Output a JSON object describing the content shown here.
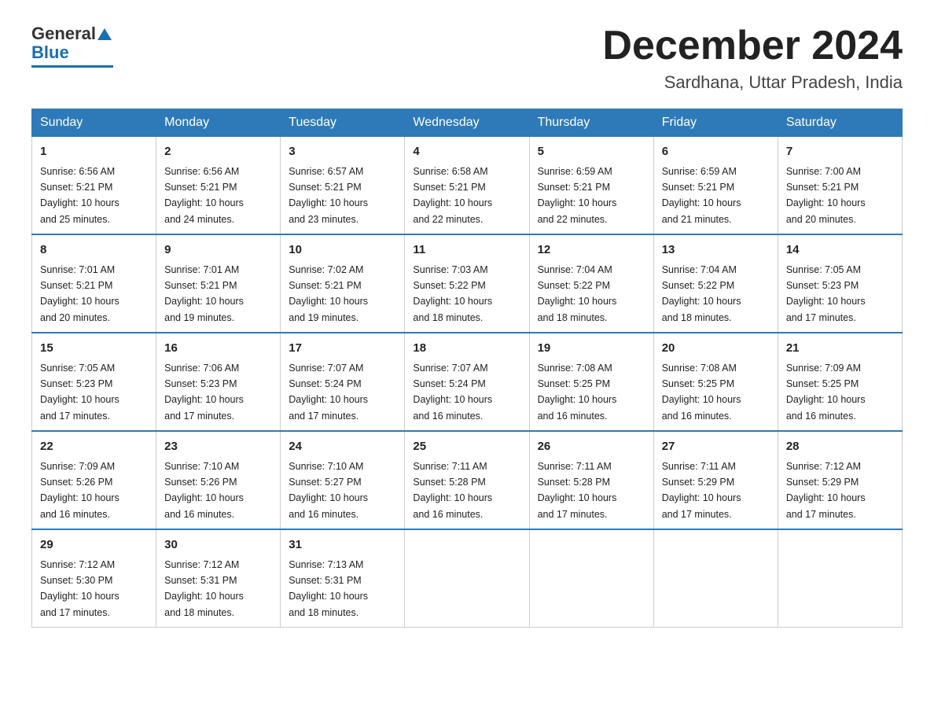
{
  "logo": {
    "general": "General",
    "blue": "Blue"
  },
  "title": {
    "month": "December 2024",
    "location": "Sardhana, Uttar Pradesh, India"
  },
  "headers": [
    "Sunday",
    "Monday",
    "Tuesday",
    "Wednesday",
    "Thursday",
    "Friday",
    "Saturday"
  ],
  "weeks": [
    [
      {
        "day": "1",
        "sunrise": "6:56 AM",
        "sunset": "5:21 PM",
        "daylight": "10 hours and 25 minutes."
      },
      {
        "day": "2",
        "sunrise": "6:56 AM",
        "sunset": "5:21 PM",
        "daylight": "10 hours and 24 minutes."
      },
      {
        "day": "3",
        "sunrise": "6:57 AM",
        "sunset": "5:21 PM",
        "daylight": "10 hours and 23 minutes."
      },
      {
        "day": "4",
        "sunrise": "6:58 AM",
        "sunset": "5:21 PM",
        "daylight": "10 hours and 22 minutes."
      },
      {
        "day": "5",
        "sunrise": "6:59 AM",
        "sunset": "5:21 PM",
        "daylight": "10 hours and 22 minutes."
      },
      {
        "day": "6",
        "sunrise": "6:59 AM",
        "sunset": "5:21 PM",
        "daylight": "10 hours and 21 minutes."
      },
      {
        "day": "7",
        "sunrise": "7:00 AM",
        "sunset": "5:21 PM",
        "daylight": "10 hours and 20 minutes."
      }
    ],
    [
      {
        "day": "8",
        "sunrise": "7:01 AM",
        "sunset": "5:21 PM",
        "daylight": "10 hours and 20 minutes."
      },
      {
        "day": "9",
        "sunrise": "7:01 AM",
        "sunset": "5:21 PM",
        "daylight": "10 hours and 19 minutes."
      },
      {
        "day": "10",
        "sunrise": "7:02 AM",
        "sunset": "5:21 PM",
        "daylight": "10 hours and 19 minutes."
      },
      {
        "day": "11",
        "sunrise": "7:03 AM",
        "sunset": "5:22 PM",
        "daylight": "10 hours and 18 minutes."
      },
      {
        "day": "12",
        "sunrise": "7:04 AM",
        "sunset": "5:22 PM",
        "daylight": "10 hours and 18 minutes."
      },
      {
        "day": "13",
        "sunrise": "7:04 AM",
        "sunset": "5:22 PM",
        "daylight": "10 hours and 18 minutes."
      },
      {
        "day": "14",
        "sunrise": "7:05 AM",
        "sunset": "5:23 PM",
        "daylight": "10 hours and 17 minutes."
      }
    ],
    [
      {
        "day": "15",
        "sunrise": "7:05 AM",
        "sunset": "5:23 PM",
        "daylight": "10 hours and 17 minutes."
      },
      {
        "day": "16",
        "sunrise": "7:06 AM",
        "sunset": "5:23 PM",
        "daylight": "10 hours and 17 minutes."
      },
      {
        "day": "17",
        "sunrise": "7:07 AM",
        "sunset": "5:24 PM",
        "daylight": "10 hours and 17 minutes."
      },
      {
        "day": "18",
        "sunrise": "7:07 AM",
        "sunset": "5:24 PM",
        "daylight": "10 hours and 16 minutes."
      },
      {
        "day": "19",
        "sunrise": "7:08 AM",
        "sunset": "5:25 PM",
        "daylight": "10 hours and 16 minutes."
      },
      {
        "day": "20",
        "sunrise": "7:08 AM",
        "sunset": "5:25 PM",
        "daylight": "10 hours and 16 minutes."
      },
      {
        "day": "21",
        "sunrise": "7:09 AM",
        "sunset": "5:25 PM",
        "daylight": "10 hours and 16 minutes."
      }
    ],
    [
      {
        "day": "22",
        "sunrise": "7:09 AM",
        "sunset": "5:26 PM",
        "daylight": "10 hours and 16 minutes."
      },
      {
        "day": "23",
        "sunrise": "7:10 AM",
        "sunset": "5:26 PM",
        "daylight": "10 hours and 16 minutes."
      },
      {
        "day": "24",
        "sunrise": "7:10 AM",
        "sunset": "5:27 PM",
        "daylight": "10 hours and 16 minutes."
      },
      {
        "day": "25",
        "sunrise": "7:11 AM",
        "sunset": "5:28 PM",
        "daylight": "10 hours and 16 minutes."
      },
      {
        "day": "26",
        "sunrise": "7:11 AM",
        "sunset": "5:28 PM",
        "daylight": "10 hours and 17 minutes."
      },
      {
        "day": "27",
        "sunrise": "7:11 AM",
        "sunset": "5:29 PM",
        "daylight": "10 hours and 17 minutes."
      },
      {
        "day": "28",
        "sunrise": "7:12 AM",
        "sunset": "5:29 PM",
        "daylight": "10 hours and 17 minutes."
      }
    ],
    [
      {
        "day": "29",
        "sunrise": "7:12 AM",
        "sunset": "5:30 PM",
        "daylight": "10 hours and 17 minutes."
      },
      {
        "day": "30",
        "sunrise": "7:12 AM",
        "sunset": "5:31 PM",
        "daylight": "10 hours and 18 minutes."
      },
      {
        "day": "31",
        "sunrise": "7:13 AM",
        "sunset": "5:31 PM",
        "daylight": "10 hours and 18 minutes."
      },
      null,
      null,
      null,
      null
    ]
  ],
  "labels": {
    "sunrise": "Sunrise:",
    "sunset": "Sunset:",
    "daylight": "Daylight:"
  }
}
